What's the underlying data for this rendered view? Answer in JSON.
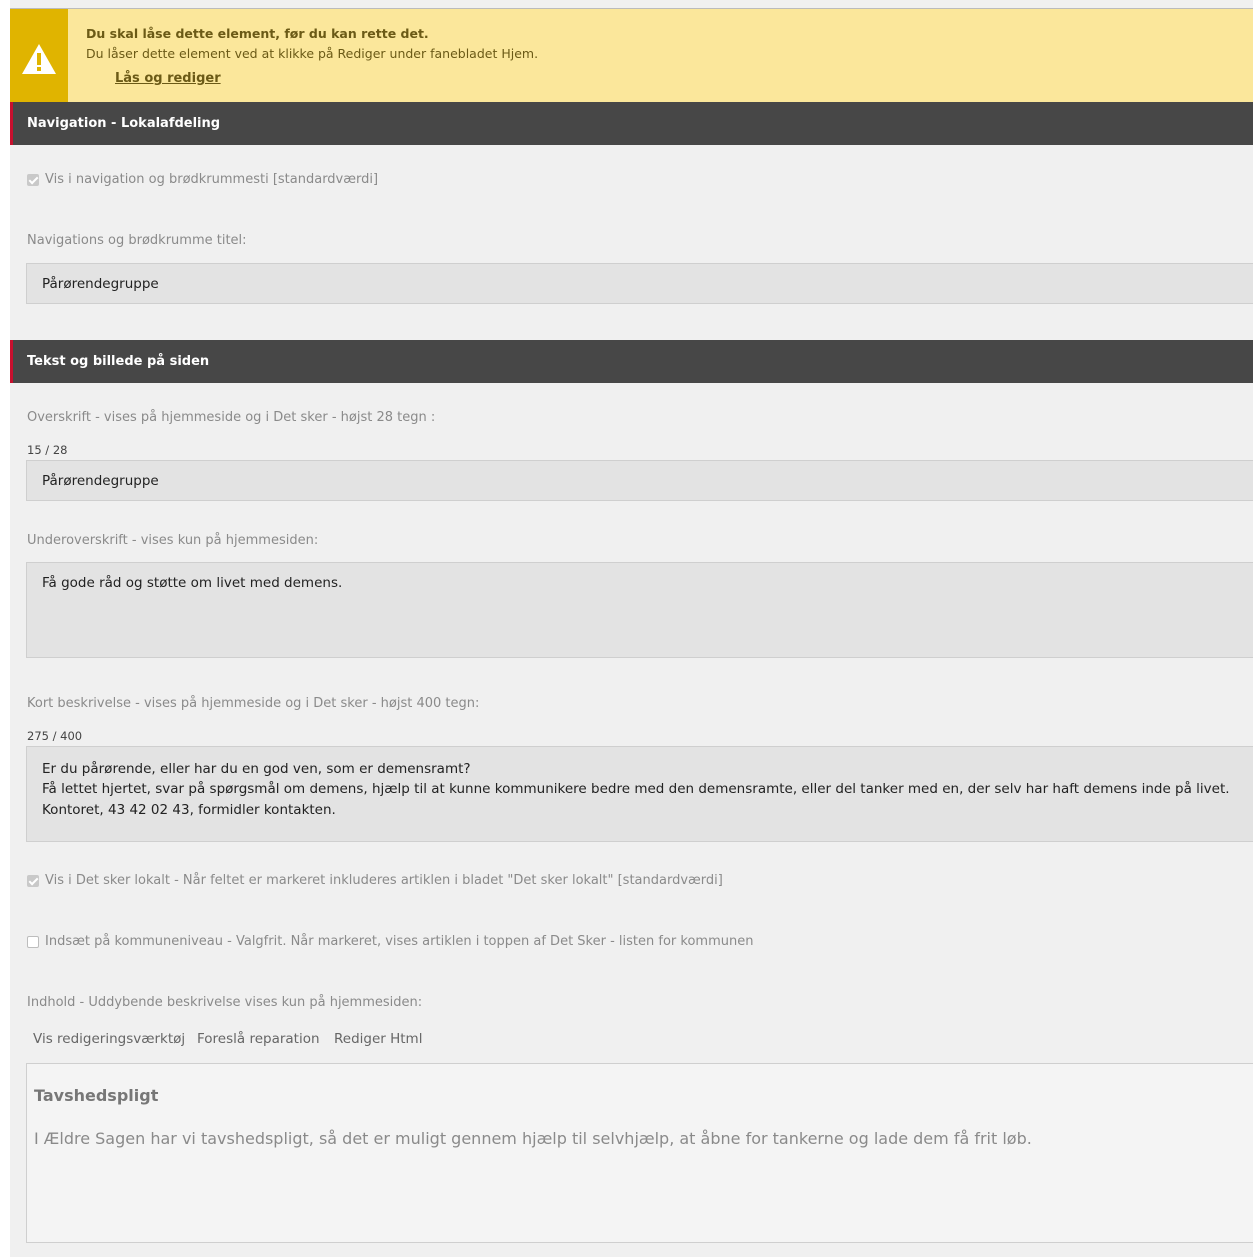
{
  "warning": {
    "title": "Du skal låse dette element, før du kan rette det.",
    "text": "Du låser dette element ved at klikke på Rediger under fanebladet Hjem.",
    "link": "Lås og rediger",
    "icon": "warning-icon"
  },
  "nav_section": {
    "header": "Navigation - Lokalafdeling",
    "show_in_nav": {
      "label": "Vis i navigation og brødkrummesti [standardværdi]",
      "checked": true
    },
    "title_label": "Navigations og brødkrumme titel:",
    "title_value": "Pårørendegruppe"
  },
  "content_section": {
    "header": "Tekst og billede på siden",
    "headline": {
      "label": "Overskrift - vises på hjemmeside og i Det sker - højst 28 tegn :",
      "counter": "15 / 28",
      "value": "Pårørendegruppe"
    },
    "subheadline": {
      "label": "Underoverskrift - vises kun på hjemmesiden:",
      "value": "Få gode råd og støtte om livet med demens."
    },
    "short_description": {
      "label": "Kort beskrivelse - vises på hjemmeside og i Det sker - højst 400 tegn:",
      "counter": "275 / 400",
      "lines": [
        "Er du pårørende, eller har du en god ven, som er demensramt?",
        "Få lettet hjertet, svar på spørgsmål om demens, hjælp til at kunne kommunikere bedre med den demensramte, eller del tanker med en, der selv har haft demens inde på livet.",
        "Kontoret, 43 42 02 43, formidler kontakten."
      ]
    },
    "show_local": {
      "label": "Vis i Det sker lokalt - Når feltet er markeret inkluderes artiklen i bladet \"Det sker lokalt\" [standardværdi]",
      "checked": true
    },
    "municipality": {
      "label": "Indsæt på kommuneniveau - Valgfrit. Når markeret, vises artiklen i toppen af Det Sker - listen for kommunen",
      "checked": false
    },
    "content": {
      "label": "Indhold - Uddybende beskrivelse vises kun på hjemmesiden:",
      "toolbar": [
        "Vis redigeringsværktøj",
        "Foreslå reparation",
        "Rediger Html"
      ],
      "heading": "Tavshedspligt",
      "body": "I Ældre Sagen har vi tavshedspligt, så det er muligt gennem hjælp til selvhjælp, at åbne for tankerne og lade dem få frit løb."
    }
  }
}
